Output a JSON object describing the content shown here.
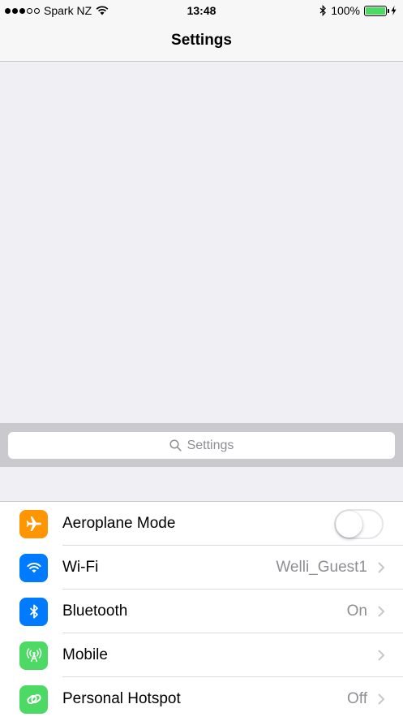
{
  "status_bar": {
    "carrier": "Spark NZ",
    "time": "13:48",
    "battery_percent": "100%",
    "battery_level": 1.0,
    "signal_bars_filled": 3,
    "signal_bars_total": 5
  },
  "nav": {
    "title": "Settings"
  },
  "search": {
    "placeholder": "Settings"
  },
  "settings_items": [
    {
      "label": "Aeroplane Mode",
      "icon": "airplane-icon",
      "icon_color": "#ff9500",
      "control": "toggle",
      "toggle_on": false
    },
    {
      "label": "Wi-Fi",
      "icon": "wifi-icon",
      "icon_color": "#007aff",
      "value": "Welli_Guest1",
      "control": "chevron"
    },
    {
      "label": "Bluetooth",
      "icon": "bluetooth-icon",
      "icon_color": "#007aff",
      "value": "On",
      "control": "chevron"
    },
    {
      "label": "Mobile",
      "icon": "antenna-icon",
      "icon_color": "#4cd964",
      "value": "",
      "control": "chevron"
    },
    {
      "label": "Personal Hotspot",
      "icon": "hotspot-icon",
      "icon_color": "#4cd964",
      "value": "Off",
      "control": "chevron"
    }
  ],
  "colors": {
    "accent_blue": "#007aff",
    "orange": "#ff9500",
    "green": "#4cd964",
    "background": "#efeff4"
  }
}
